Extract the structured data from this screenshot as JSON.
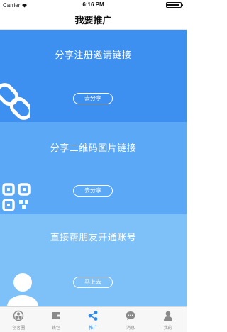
{
  "status_bar": {
    "carrier": "Carrier",
    "time": "6:16 PM"
  },
  "nav": {
    "title": "我要推广"
  },
  "cards": [
    {
      "title": "分享注册邀请链接",
      "button": "去分享",
      "icon": "link-icon",
      "bg": "#3d8ff0"
    },
    {
      "title": "分享二维码图片链接",
      "button": "去分享",
      "icon": "qr-code-icon",
      "bg": "#5aa8f6"
    },
    {
      "title": "直接帮朋友开通账号",
      "button": "马上去",
      "icon": "user-icon",
      "bg": "#7ec1f8"
    }
  ],
  "tabs": [
    {
      "label": "创客圈",
      "icon": "circle-icon"
    },
    {
      "label": "钱包",
      "icon": "wallet-icon"
    },
    {
      "label": "推广",
      "icon": "share-icon",
      "active": true
    },
    {
      "label": "消息",
      "icon": "message-icon"
    },
    {
      "label": "我的",
      "icon": "person-icon"
    }
  ],
  "colors": {
    "accent": "#2a8af0",
    "tab_inactive": "#8a8a8a"
  }
}
